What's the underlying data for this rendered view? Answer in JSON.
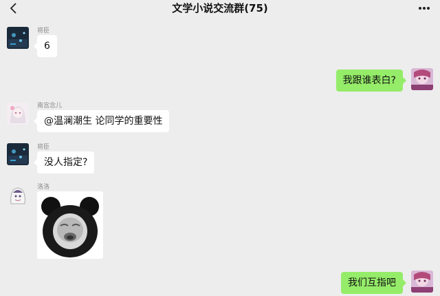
{
  "header": {
    "title": "文学小说交流群(75)",
    "back_icon": "chevron-left-icon",
    "more_icon": "more-dots-icon"
  },
  "messages": [
    {
      "sender": "将臣",
      "text": "6",
      "direction": "in",
      "avatar": "dark-blue-avatar"
    },
    {
      "sender": "",
      "text": "我跟谁表白?",
      "direction": "out",
      "avatar": "anime-girl-avatar"
    },
    {
      "sender": "南宫念儿",
      "text": "@温澜潮生 论同学的重要性",
      "direction": "in",
      "avatar": "anime-white-hair-avatar"
    },
    {
      "sender": "将臣",
      "text": "没人指定?",
      "direction": "in",
      "avatar": "dark-blue-avatar"
    },
    {
      "sender": "洛洛",
      "text": "",
      "direction": "in",
      "avatar": "anime-ghost-avatar",
      "sticker": "panda-meme-sticker"
    },
    {
      "sender": "",
      "text": "我们互指吧",
      "direction": "out",
      "avatar": "anime-girl-avatar"
    }
  ],
  "colors": {
    "background": "#ededed",
    "incoming_bubble": "#ffffff",
    "outgoing_bubble": "#95ec69",
    "name_text": "#8a8a8a"
  }
}
